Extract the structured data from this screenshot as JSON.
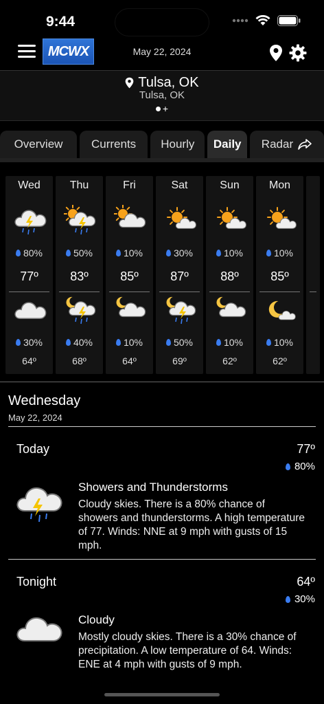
{
  "status": {
    "time": "9:44"
  },
  "header": {
    "logo": "MCWX",
    "date": "May 22, 2024"
  },
  "location": {
    "city": "Tulsa, OK",
    "sub": "Tulsa, OK",
    "add": "+"
  },
  "tabs": [
    {
      "label": "Overview",
      "active": false
    },
    {
      "label": "Currents",
      "active": false
    },
    {
      "label": "Hourly",
      "active": false
    },
    {
      "label": "Daily",
      "active": true
    },
    {
      "label": "Radar",
      "active": false
    }
  ],
  "days": [
    {
      "name": "Wed",
      "day_icon": "cloud-storm-icon",
      "day_pop": "80%",
      "hi": "77º",
      "night_icon": "cloud-icon",
      "night_pop": "30%",
      "lo": "64º"
    },
    {
      "name": "Thu",
      "day_icon": "sun-cloud-storm-icon",
      "day_pop": "50%",
      "hi": "83º",
      "night_icon": "moon-cloud-storm-icon",
      "night_pop": "40%",
      "lo": "68º"
    },
    {
      "name": "Fri",
      "day_icon": "sun-cloud-icon",
      "day_pop": "10%",
      "hi": "85º",
      "night_icon": "moon-cloud-icon",
      "night_pop": "10%",
      "lo": "64º"
    },
    {
      "name": "Sat",
      "day_icon": "sun-partly-cloud-icon",
      "day_pop": "30%",
      "hi": "87º",
      "night_icon": "moon-cloud-storm-icon",
      "night_pop": "50%",
      "lo": "69º"
    },
    {
      "name": "Sun",
      "day_icon": "sun-partly-cloud-icon",
      "day_pop": "10%",
      "hi": "88º",
      "night_icon": "moon-cloud-icon",
      "night_pop": "10%",
      "lo": "62º"
    },
    {
      "name": "Mon",
      "day_icon": "sun-partly-cloud-icon",
      "day_pop": "10%",
      "hi": "85º",
      "night_icon": "moon-small-cloud-icon",
      "night_pop": "10%",
      "lo": "62º"
    }
  ],
  "detail": {
    "day_name": "Wednesday",
    "date": "May 22, 2024",
    "periods": [
      {
        "label": "Today",
        "temp": "77º",
        "pop": "80%",
        "icon": "cloud-storm-icon",
        "title": "Showers and Thunderstorms",
        "text": "Cloudy skies. There is a 80% chance of showers and thunderstorms. A high temperature of 77. Winds: NNE at 9 mph with gusts of 15 mph."
      },
      {
        "label": "Tonight",
        "temp": "64º",
        "pop": "30%",
        "icon": "cloud-icon",
        "title": "Cloudy",
        "text": "Mostly cloudy skies. There is a 30% chance of precipitation. A low temperature of 64. Winds: ENE at 4 mph with gusts of 9 mph."
      }
    ]
  },
  "colors": {
    "accent_blue": "#3a7cf0",
    "sun": "#f7a21b",
    "bolt": "#f5c400",
    "logo_bg": "#2f74d6"
  }
}
